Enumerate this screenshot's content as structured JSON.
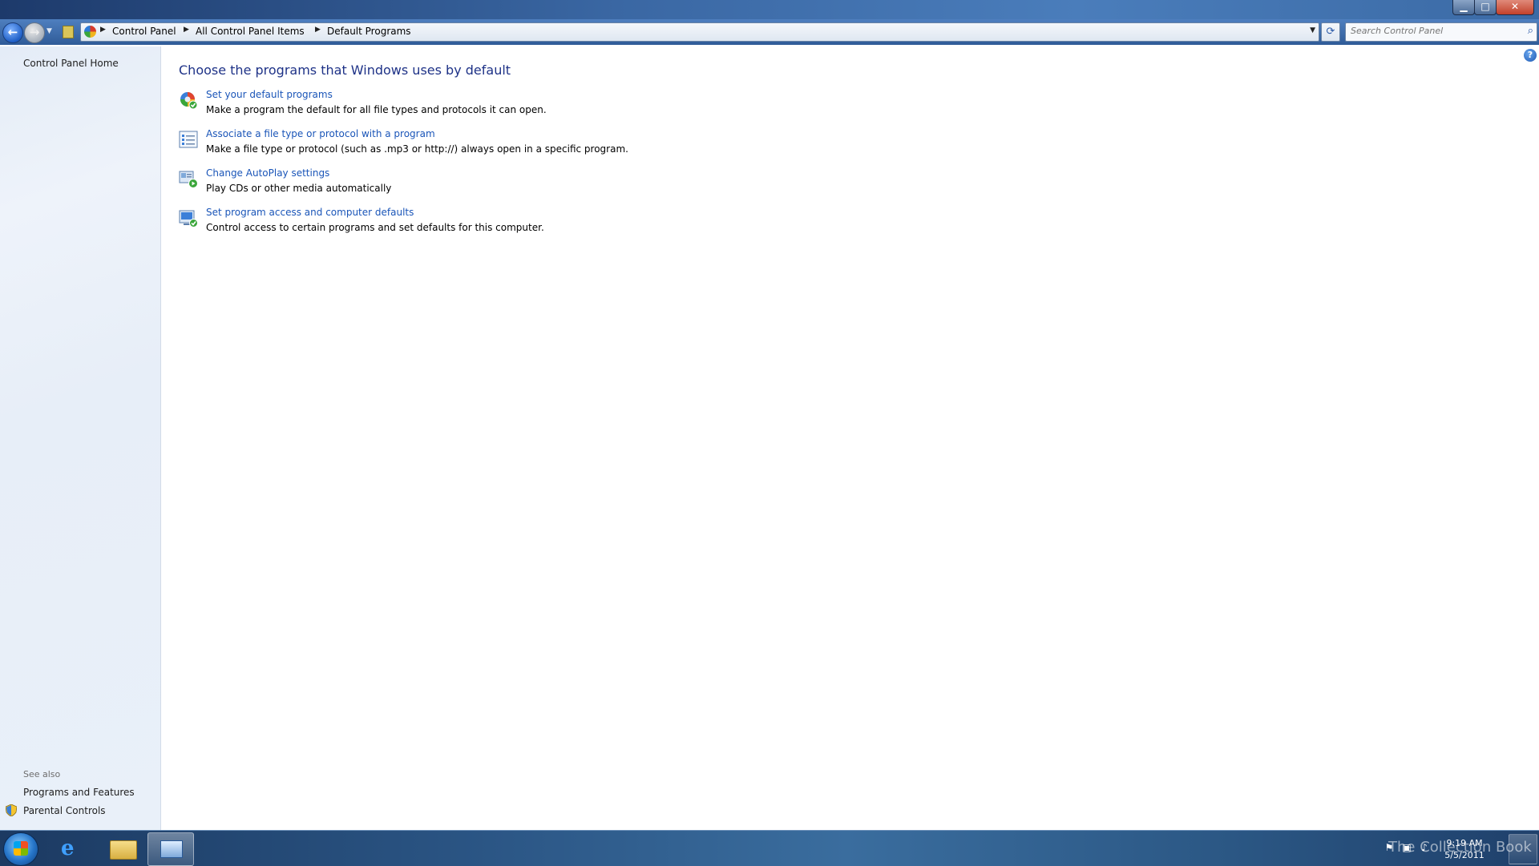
{
  "window": {
    "minimize_glyph": "▁",
    "maximize_glyph": "□",
    "close_glyph": "✕"
  },
  "navigation": {
    "back_glyph": "←",
    "forward_glyph": "→",
    "recent_glyph": "▼",
    "breadcrumbs": [
      "Control Panel",
      "All Control Panel Items",
      "Default Programs"
    ],
    "separator_glyph": "▶",
    "dropdown_glyph": "▼",
    "refresh_glyph": "⟳",
    "search_placeholder": "Search Control Panel",
    "search_glyph": "⌕"
  },
  "left_pane": {
    "home_link": "Control Panel Home",
    "see_also_label": "See also",
    "see_also_links": [
      "Programs and Features",
      "Parental Controls"
    ]
  },
  "main": {
    "title": "Choose the programs that Windows uses by default",
    "help_glyph": "?",
    "tasks": [
      {
        "link": "Set your default programs",
        "description": "Make a program the default for all file types and protocols it can open.",
        "icon": "default-programs-icon"
      },
      {
        "link": "Associate a file type or protocol with a program",
        "description": "Make a file type or protocol (such as .mp3 or http://) always open in a specific program.",
        "icon": "file-association-icon"
      },
      {
        "link": "Change AutoPlay settings",
        "description": "Play CDs or other media automatically",
        "icon": "autoplay-icon"
      },
      {
        "link": "Set program access and computer defaults",
        "description": "Control access to certain programs and set defaults for this computer.",
        "icon": "program-access-icon"
      }
    ]
  },
  "taskbar": {
    "ie_glyph": "e",
    "tray_glyphs": [
      "⚑",
      "▣",
      "♪"
    ],
    "clock_time": "9:19 AM",
    "clock_date": "5/5/2011",
    "watermark": "The Collection Book"
  },
  "colors": {
    "link": "#1a55b8",
    "title": "#1e3287"
  }
}
